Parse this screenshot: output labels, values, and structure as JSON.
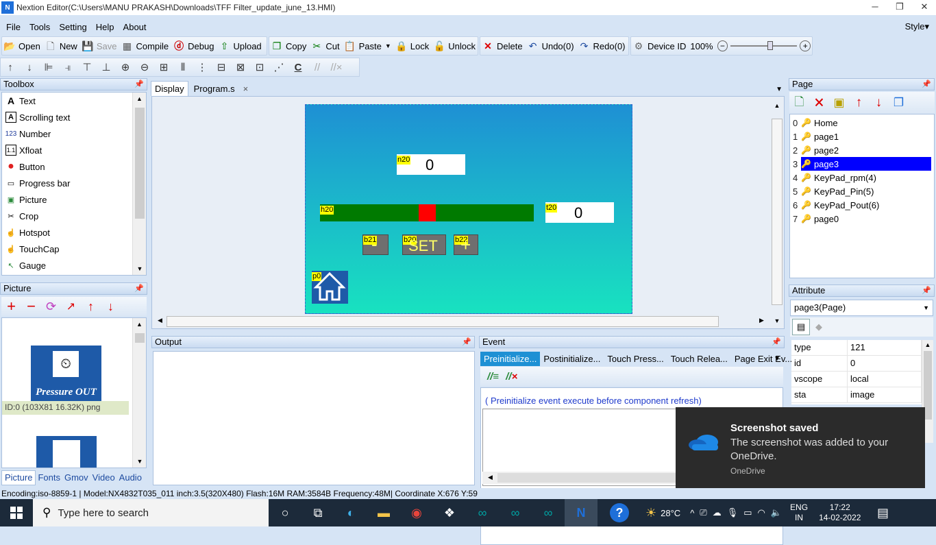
{
  "window": {
    "title": "Nextion Editor(C:\\Users\\MANU PRAKASH\\Downloads\\TFF Filter_update_june_13.HMI)",
    "logo": "N"
  },
  "menu": [
    "File",
    "Tools",
    "Setting",
    "Help",
    "About"
  ],
  "style_menu": "Style",
  "toolbar": {
    "open": "Open",
    "new": "New",
    "save": "Save",
    "compile": "Compile",
    "debug": "Debug",
    "upload": "Upload",
    "copy": "Copy",
    "cut": "Cut",
    "paste": "Paste",
    "lock": "Lock",
    "unlock": "Unlock",
    "delete": "Delete",
    "undo": "Undo(0)",
    "redo": "Redo(0)",
    "device_id": "Device ID",
    "zoom": "100%"
  },
  "toolbox": {
    "title": "Toolbox",
    "items": [
      {
        "label": "Text",
        "icon": "A"
      },
      {
        "label": "Scrolling text",
        "icon": "A"
      },
      {
        "label": "Number",
        "icon": "123"
      },
      {
        "label": "Xfloat",
        "icon": "1.1"
      },
      {
        "label": "Button",
        "icon": "●"
      },
      {
        "label": "Progress bar",
        "icon": "▭"
      },
      {
        "label": "Picture",
        "icon": "▣"
      },
      {
        "label": "Crop",
        "icon": "✂"
      },
      {
        "label": "Hotspot",
        "icon": "☝"
      },
      {
        "label": "TouchCap",
        "icon": "☝"
      },
      {
        "label": "Gauge",
        "icon": "↖"
      }
    ]
  },
  "picture_panel": {
    "title": "Picture",
    "image1_caption": "Pressure OUT",
    "image1_info": "ID:0  (103X81 16.32K) png",
    "tabs": [
      "Picture",
      "Fonts",
      "Gmov",
      "Video",
      "Audio"
    ]
  },
  "doc_tabs": {
    "display": "Display",
    "program": "Program.s",
    "close": "×"
  },
  "canvas": {
    "n20": {
      "label": "n20",
      "value": "0"
    },
    "h20": {
      "label": "h20",
      "progress": 0.5
    },
    "t20": {
      "label": "t20",
      "value": "0"
    },
    "b21": {
      "label": "b21",
      "text": "-"
    },
    "b20": {
      "label": "b20",
      "text": "SET"
    },
    "b22": {
      "label": "b22",
      "text": "+"
    },
    "p0": {
      "label": "p0"
    }
  },
  "output": {
    "title": "Output"
  },
  "event": {
    "title": "Event",
    "tabs": [
      "Preinitialize...",
      "Postinitialize...",
      "Touch Press...",
      "Touch Relea...",
      "Page Exit Ev..."
    ],
    "hint": "( Preinitialize event execute before component refresh)"
  },
  "page_panel": {
    "title": "Page",
    "pages": [
      {
        "idx": "0",
        "name": "Home"
      },
      {
        "idx": "1",
        "name": "page1"
      },
      {
        "idx": "2",
        "name": "page2"
      },
      {
        "idx": "3",
        "name": "page3",
        "selected": true
      },
      {
        "idx": "4",
        "name": "KeyPad_rpm(4)"
      },
      {
        "idx": "5",
        "name": "KeyPad_Pin(5)"
      },
      {
        "idx": "6",
        "name": "KeyPad_Pout(6)"
      },
      {
        "idx": "7",
        "name": "page0"
      }
    ]
  },
  "attribute": {
    "title": "Attribute",
    "selected": "page3(Page)",
    "rows": [
      {
        "key": "type",
        "value": "121"
      },
      {
        "key": "id",
        "value": "0"
      },
      {
        "key": "vscope",
        "value": "local"
      },
      {
        "key": "sta",
        "value": "image"
      }
    ]
  },
  "statusbar": "Encoding:iso-8859-1 | Model:NX4832T035_011 inch:3.5(320X480) Flash:16M RAM:3584B Frequency:48M|    Coordinate X:676  Y:59",
  "toast": {
    "title": "Screenshot saved",
    "body": "The screenshot was added to your OneDrive.",
    "source": "OneDrive"
  },
  "taskbar": {
    "search_placeholder": "Type here to search",
    "weather": "28°C",
    "lang1": "ENG",
    "lang2": "IN",
    "time": "17:22",
    "date": "14-02-2022"
  },
  "colors": {
    "accent": "#1e6fd9",
    "canvas_top": "#1e90d4",
    "canvas_bottom": "#18e2c0",
    "bar_green": "#007a00",
    "bar_red": "#ff0000"
  }
}
